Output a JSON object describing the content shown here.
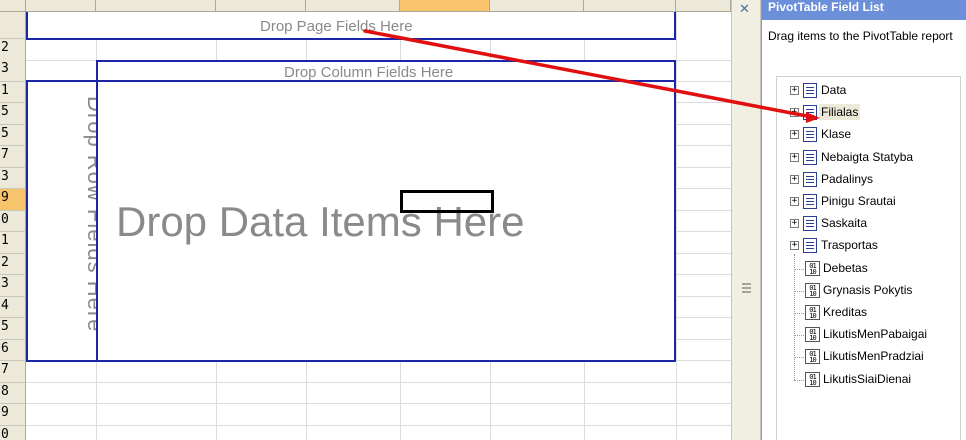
{
  "drop_zones": {
    "page": "Drop Page Fields Here",
    "column": "Drop Column Fields Here",
    "row": "Drop Row Fields Here",
    "data": "Drop Data Items Here"
  },
  "row_numbers": [
    "2",
    "3",
    "1",
    "5",
    "5",
    "7",
    "3",
    "9",
    "0",
    "1",
    "2",
    "3",
    "4",
    "5",
    "6",
    "7",
    "8",
    "9",
    "0"
  ],
  "task_pane": {
    "title": "PivotTable Field List",
    "description": "Drag items to the PivotTable report"
  },
  "fields": [
    {
      "name": "Data",
      "kind": "dimension"
    },
    {
      "name": "Filialas",
      "kind": "dimension",
      "selected": true
    },
    {
      "name": "Klase",
      "kind": "dimension"
    },
    {
      "name": "Nebaigta Statyba",
      "kind": "dimension"
    },
    {
      "name": "Padalinys",
      "kind": "dimension"
    },
    {
      "name": "Pinigu Srautai",
      "kind": "dimension"
    },
    {
      "name": "Saskaita",
      "kind": "dimension"
    },
    {
      "name": "Trasportas",
      "kind": "dimension"
    },
    {
      "name": "Debetas",
      "kind": "measure"
    },
    {
      "name": "Grynasis Pokytis",
      "kind": "measure"
    },
    {
      "name": "Kreditas",
      "kind": "measure"
    },
    {
      "name": "LikutisMenPabaigai",
      "kind": "measure"
    },
    {
      "name": "LikutisMenPradziai",
      "kind": "measure"
    },
    {
      "name": "LikutisSiaiDienai",
      "kind": "measure"
    }
  ],
  "icons": {
    "expand": "+",
    "measure_glyph": "0 1 1 0"
  },
  "colors": {
    "drop_border": "#1b27a6",
    "arrow": "#e01010",
    "header_selected": "#f7c46c"
  }
}
